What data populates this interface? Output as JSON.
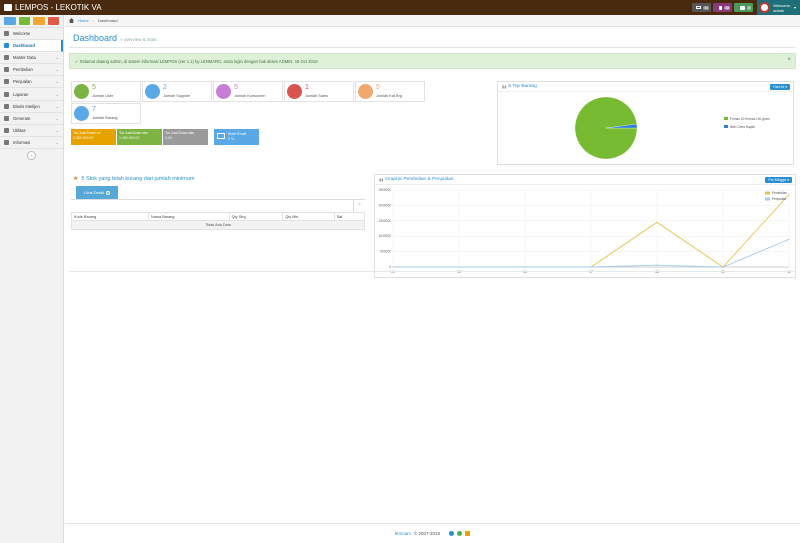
{
  "app": {
    "title": "LEMPOS - LEKOTIK VA"
  },
  "topnav": {
    "badges": [
      {
        "icon": "envelope-icon",
        "count": "44",
        "color": "#555555"
      },
      {
        "icon": "user-icon",
        "count": "88",
        "color": "#8a3a7a"
      },
      {
        "icon": "chat-icon",
        "count": "0",
        "color": "#4c9a5a"
      }
    ],
    "user": {
      "greeting": "Welcome,",
      "name": "admin"
    }
  },
  "sidebar": {
    "items": [
      {
        "label": "Welcome",
        "icon": "home-icon",
        "has_children": false,
        "active": false
      },
      {
        "label": "Dashboard",
        "icon": "dashboard-icon",
        "has_children": false,
        "active": true
      },
      {
        "label": "Master Data",
        "icon": "list-icon",
        "has_children": true,
        "active": false
      },
      {
        "label": "Pembelian",
        "icon": "cart-icon",
        "has_children": true,
        "active": false
      },
      {
        "label": "Penjualan",
        "icon": "tag-icon",
        "has_children": true,
        "active": false
      },
      {
        "label": "Laporan",
        "icon": "report-icon",
        "has_children": true,
        "active": false
      },
      {
        "label": "Bisnis Intelijen",
        "icon": "chart-icon",
        "has_children": true,
        "active": false
      },
      {
        "label": "Generate",
        "icon": "cog-icon",
        "has_children": true,
        "active": false
      },
      {
        "label": "Utilitas",
        "icon": "tools-icon",
        "has_children": true,
        "active": false
      },
      {
        "label": "Informasi",
        "icon": "info-icon",
        "has_children": true,
        "active": false
      }
    ]
  },
  "breadcrumb": {
    "home": "Home",
    "current": "Dashboard"
  },
  "page": {
    "title": "Dashboard",
    "subtitle": "» overview & stats"
  },
  "alert": {
    "message": "✓ Selamat datang admin, di sistem informasi LEMPOS (ver 1.1) by LENMARC, anda login dengan hak akses ADMIN. 16 Oct 2019",
    "close": "×"
  },
  "stats": [
    {
      "value": "5",
      "label": "Jumlah User",
      "color": "#7cb342",
      "icon": "users-icon"
    },
    {
      "value": "2",
      "label": "Jumlah Supplier",
      "color": "#5aa9e6",
      "icon": "truck-icon"
    },
    {
      "value": "5",
      "label": "Jumlah Konsumen",
      "color": "#c77dd6",
      "icon": "people-icon"
    },
    {
      "value": "1",
      "label": "Jumlah Sales",
      "color": "#d9534f",
      "icon": "person-icon"
    },
    {
      "value": "5",
      "label": "Jumlah Kat Brg",
      "color": "#f0a870",
      "icon": "tags-icon"
    },
    {
      "value": "7",
      "label": "Jumlah Barang",
      "color": "#5aa9e6",
      "icon": "box-icon"
    }
  ],
  "tiles": [
    {
      "label": "Tot Jual Bulan Ini",
      "value": "2.350.000,00",
      "color": "#e8a200"
    },
    {
      "label": "Tot Jual Bulan lalu",
      "value": "1.450.000,00",
      "color": "#7cb342"
    },
    {
      "label": "Tot Jual Bulan lalu",
      "value": "0,00",
      "color": "#9a9a9a"
    },
    {
      "label": "Kirim Email",
      "value": "0 %",
      "color": "#5aa9e6"
    }
  ],
  "top_barang": {
    "title": "5 Top Barang",
    "button": "Hari Ini ▾",
    "chart_data": {
      "type": "pie",
      "labels": [
        "Pomaz 40 Kemas 100 gram",
        "Nish Ceria Hayati"
      ],
      "values": [
        98,
        2
      ],
      "colors": [
        "#77bb33",
        "#2a7fd4"
      ]
    }
  },
  "stok": {
    "title": "5 Stok yang telah kurang dari jumlah minimum",
    "button": "Lihat Detail",
    "columns": [
      "Kode Barang",
      "Nama Barang",
      "Qty Strg",
      "Qty Min",
      "Sat"
    ],
    "empty": "Tidak Ada Data"
  },
  "graphic": {
    "title": "Graphic Pembelian & Penjualan",
    "button": "Per Minggu ▾",
    "chart_data": {
      "type": "line",
      "x": [
        "04",
        "05",
        "06",
        "07",
        "08",
        "09",
        "10"
      ],
      "y_ticks": [
        "2500000",
        "2000000",
        "1500000",
        "1000000",
        "500000",
        "0"
      ],
      "ylim": [
        0,
        2500000
      ],
      "legend": "top-right",
      "series": [
        {
          "name": "Pembelian",
          "color": "#e8c050",
          "values": [
            0,
            0,
            0,
            0,
            1450000,
            0,
            2350000
          ]
        },
        {
          "name": "Penjualan",
          "color": "#a8cce8",
          "values": [
            0,
            0,
            0,
            0,
            60000,
            0,
            900000
          ]
        }
      ]
    }
  },
  "footer": {
    "brand": "lenmarc",
    "text": "© 2007-2019"
  }
}
